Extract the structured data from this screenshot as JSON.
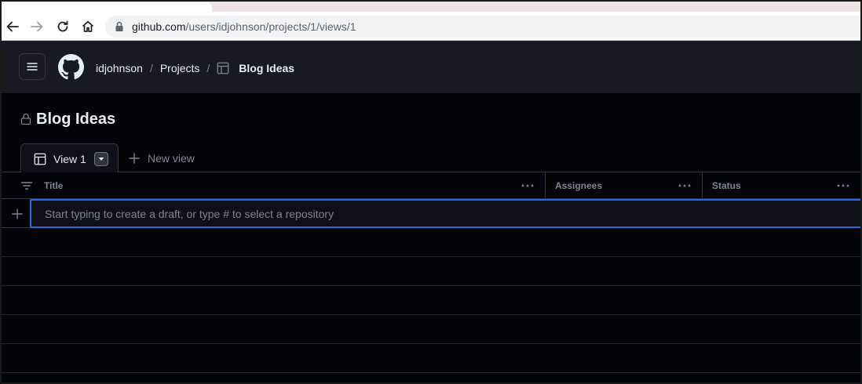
{
  "browser": {
    "url_host": "github.com",
    "url_path": "/users/idjohnson/projects/1/views/1",
    "back_icon": "arrow-left-icon",
    "forward_icon": "arrow-right-icon",
    "reload_icon": "reload-icon",
    "home_icon": "home-icon"
  },
  "header": {
    "breadcrumb": {
      "user": "idjohnson",
      "section": "Projects",
      "project": "Blog Ideas"
    }
  },
  "project": {
    "title": "Blog Ideas"
  },
  "views": {
    "tabs": [
      {
        "label": "View 1"
      }
    ],
    "new_view_label": "New view"
  },
  "table": {
    "columns": [
      {
        "label": "Title"
      },
      {
        "label": "Assignees"
      },
      {
        "label": "Status"
      }
    ],
    "draft_placeholder": "Start typing to create a draft, or type # to select a repository",
    "rows": []
  },
  "colors": {
    "background": "#010409",
    "header_bg": "#161b22",
    "accent": "#1f6feb",
    "border": "#30363d",
    "muted_text": "#7d8590"
  }
}
